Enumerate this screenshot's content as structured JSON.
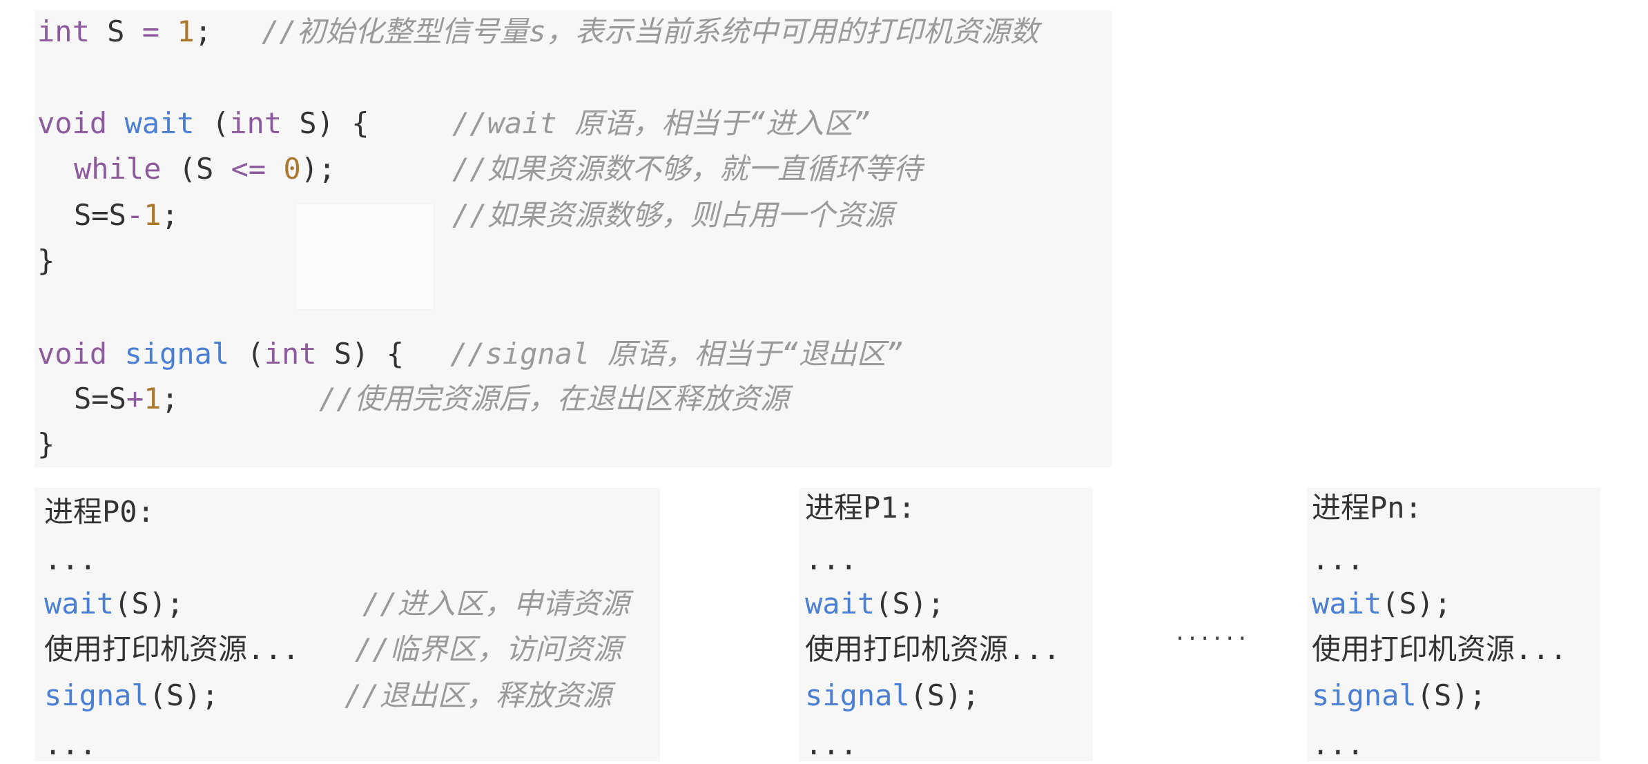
{
  "definition": {
    "line1": {
      "kw": "int",
      "var": " S ",
      "op": "=",
      "sp": " ",
      "num": "1",
      "end": ";",
      "comment": "//初始化整型信号量s，表示当前系统中可用的打印机资源数"
    },
    "wait_sig": {
      "kw": "void",
      "fn": "wait",
      "open": " (",
      "kw2": "int",
      "rest": " S) {",
      "comment": "//wait 原语，相当于“进入区”"
    },
    "while_line": {
      "kw": "while",
      "a": " (S ",
      "op": "<=",
      "sp": " ",
      "num": "0",
      "end": ");",
      "comment": "//如果资源数不够，就一直循环等待"
    },
    "dec_line": {
      "a": "S=S",
      "op": "-",
      "num": "1",
      "end": ";",
      "comment": "//如果资源数够，则占用一个资源"
    },
    "close1": "}",
    "signal_sig": {
      "kw": "void",
      "fn": "signal",
      "open": " (",
      "kw2": "int",
      "rest": " S) {",
      "comment": "//signal 原语，相当于“退出区”"
    },
    "inc_line": {
      "a": "S=S",
      "op": "+",
      "num": "1",
      "end": ";",
      "comment": "//使用完资源后，在退出区释放资源"
    },
    "close2": "}"
  },
  "processes": [
    {
      "title": "进程P0:",
      "dots1": "...",
      "wait_fn": "wait",
      "wait_args": "(S);",
      "wait_comment": "//进入区，申请资源",
      "use": "使用打印机资源...",
      "use_comment": "//临界区，访问资源",
      "signal_fn": "signal",
      "signal_args": "(S);",
      "signal_comment": "//退出区，释放资源",
      "dots2": "..."
    },
    {
      "title": "进程P1:",
      "dots1": "...",
      "wait_fn": "wait",
      "wait_args": "(S);",
      "use": "使用打印机资源...",
      "signal_fn": "signal",
      "signal_args": "(S);",
      "dots2": "..."
    },
    {
      "title": "进程Pn:",
      "dots1": "...",
      "wait_fn": "wait",
      "wait_args": "(S);",
      "use": "使用打印机资源...",
      "signal_fn": "signal",
      "signal_args": "(S);",
      "dots2": "..."
    }
  ],
  "between_ellipsis": "......",
  "colors": {
    "keyword": "#8e5a9e",
    "function": "#4a7fd4",
    "number": "#a9782c",
    "comment": "#9a9a9a",
    "block_bg": "#f7f7f7"
  }
}
